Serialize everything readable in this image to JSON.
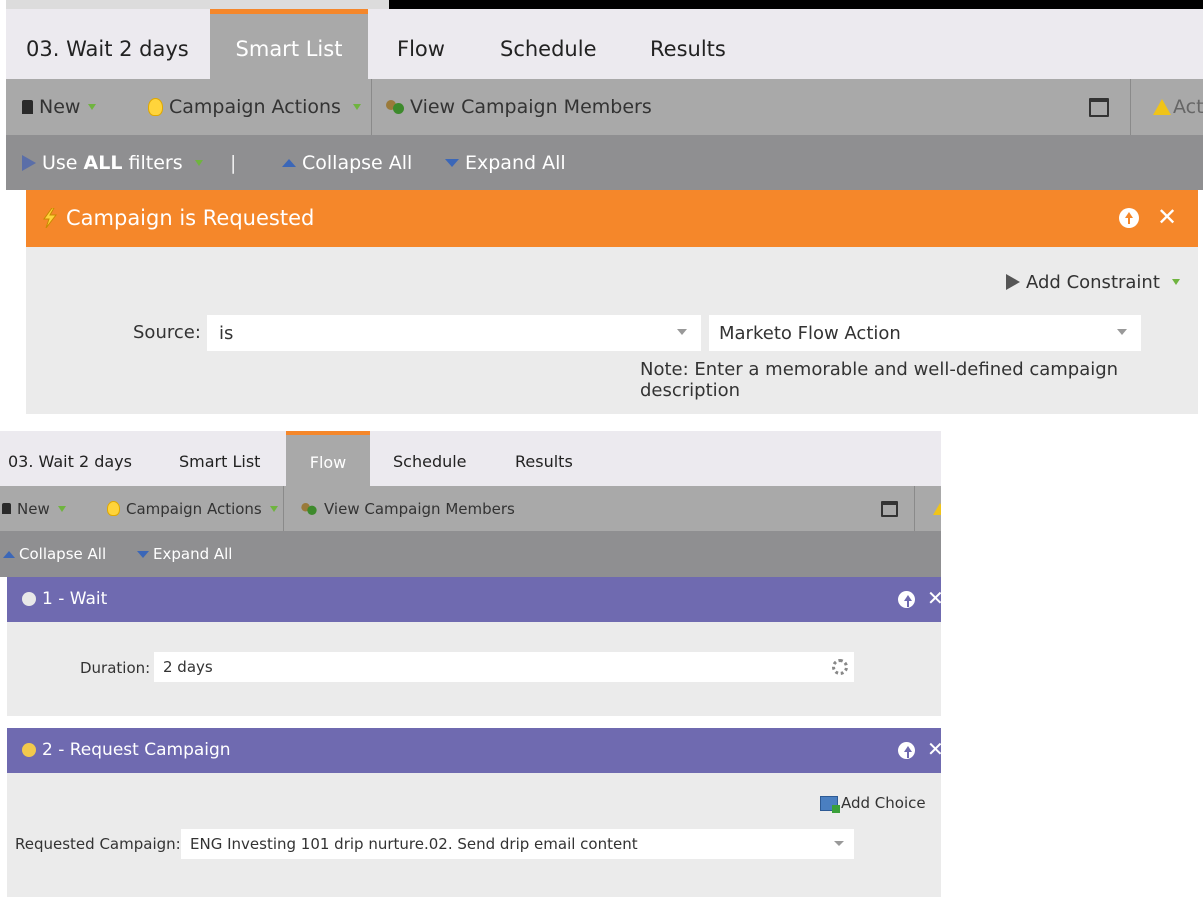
{
  "panel1": {
    "tabs": [
      {
        "label": "03. Wait 2 days",
        "active": false
      },
      {
        "label": "Smart List",
        "active": true
      },
      {
        "label": "Flow",
        "active": false
      },
      {
        "label": "Schedule",
        "active": false
      },
      {
        "label": "Results",
        "active": false
      }
    ],
    "toolbar": {
      "new_label": "New",
      "campaign_actions_label": "Campaign Actions",
      "view_members_label": "View Campaign Members",
      "activity_label": "Act"
    },
    "filterbar": {
      "use_prefix": "Use ",
      "use_bold": "ALL",
      "use_suffix": " filters",
      "separator": "|",
      "collapse_label": "Collapse All",
      "expand_label": "Expand All"
    },
    "trigger": {
      "title": "Campaign is Requested",
      "add_constraint_label": "Add Constraint",
      "source_label": "Source:",
      "operator_value": "is",
      "source_value": "Marketo Flow Action",
      "note": "Note: Enter a memorable and well-defined campaign description"
    }
  },
  "panel2": {
    "tabs": [
      {
        "label": "03. Wait 2 days",
        "active": false
      },
      {
        "label": "Smart List",
        "active": false
      },
      {
        "label": "Flow",
        "active": true
      },
      {
        "label": "Schedule",
        "active": false
      },
      {
        "label": "Results",
        "active": false
      }
    ],
    "toolbar": {
      "new_label": "New",
      "campaign_actions_label": "Campaign Actions",
      "view_members_label": "View Campaign Members"
    },
    "filterbar": {
      "collapse_label": "Collapse All",
      "expand_label": "Expand All"
    },
    "steps": [
      {
        "title": "1 - Wait",
        "field_label": "Duration:",
        "field_value": "2 days"
      },
      {
        "title": "2 - Request Campaign",
        "add_choice_label": "Add Choice",
        "field_label": "Requested Campaign:",
        "field_value": "ENG Investing 101 drip nurture.02. Send drip email content"
      }
    ]
  },
  "colors": {
    "accent_orange": "#f5872a",
    "flow_purple": "#6f6ab0",
    "toolbar_gray": "#a9a9a9",
    "filterbar_gray": "#8f8f91",
    "tab_bg": "#eceaef"
  }
}
